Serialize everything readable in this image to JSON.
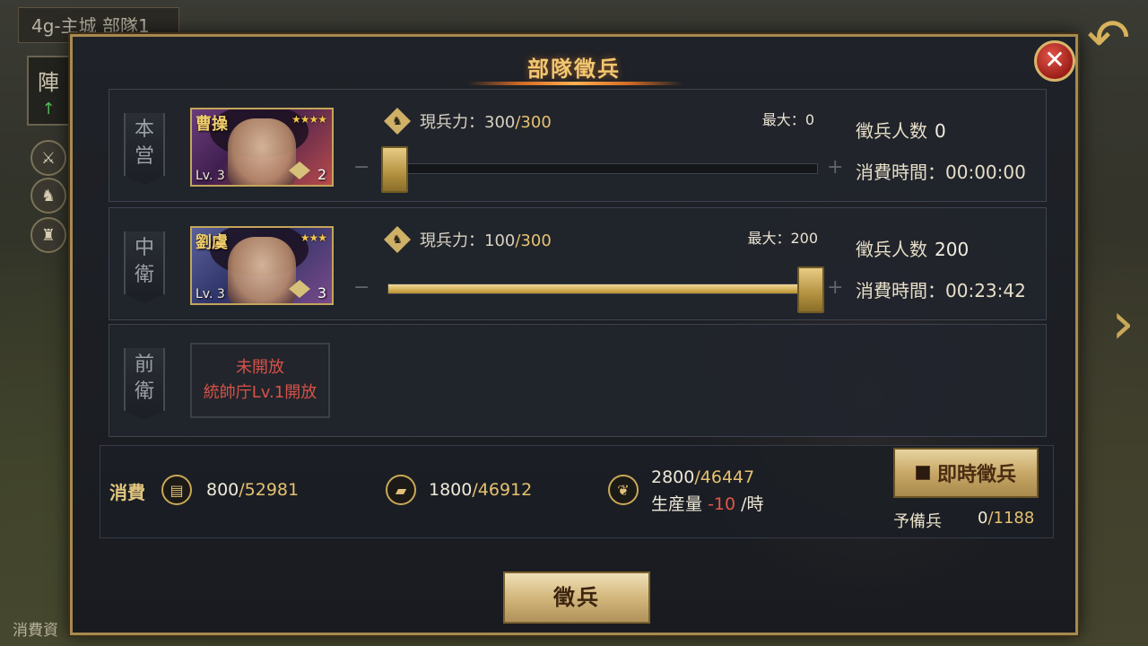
{
  "background": {
    "city_label": "4g-主城 部隊1",
    "side_tab": "陣",
    "side_tab_arrow": "↑",
    "bottom_left_text": "消費資"
  },
  "modal": {
    "title": "部隊徵兵",
    "close": "✕"
  },
  "rows": [
    {
      "position": [
        "本",
        "営"
      ],
      "hero": {
        "name": "曹操",
        "stars": "★★★★",
        "level": "Lv. 3",
        "type_count": "2"
      },
      "troops_label": "現兵力：",
      "troops_current": "300",
      "troops_max": "/300",
      "max_label": "最大：",
      "max_value": "0",
      "slider_percent": 0,
      "recruit_label": "徵兵人数",
      "recruit_value": "0",
      "time_label": "消費時間：",
      "time_value": "00:00:00"
    },
    {
      "position": [
        "中",
        "衛"
      ],
      "hero": {
        "name": "劉虞",
        "stars": "★★★",
        "level": "Lv. 3",
        "type_count": "3"
      },
      "troops_label": "現兵力：",
      "troops_current": "100",
      "troops_max": "/300",
      "max_label": "最大：",
      "max_value": "200",
      "slider_percent": 100,
      "recruit_label": "徵兵人数",
      "recruit_value": "200",
      "time_label": "消費時間：",
      "time_value": "00:23:42"
    },
    {
      "position": [
        "前",
        "衛"
      ],
      "locked_line1": "未開放",
      "locked_line2": "統帥庁Lv.1開放"
    }
  ],
  "cost": {
    "label": "消費",
    "res1_current": "800",
    "res1_total": "/52981",
    "res2_current": "1800",
    "res2_total": "/46912",
    "res3_current": "2800",
    "res3_total": "/46447",
    "production_label": "生産量",
    "production_value": "-10",
    "production_unit": "/時"
  },
  "instant_button": "即時徵兵",
  "reserve": {
    "label": "予備兵",
    "current": "0",
    "total": "/1188"
  },
  "recruit_button": "徵兵",
  "colors": {
    "accent_gold": "#e6c170",
    "slider_gold": "#c9a857",
    "locked_red": "#d6524a",
    "production_red": "#e0564a"
  }
}
